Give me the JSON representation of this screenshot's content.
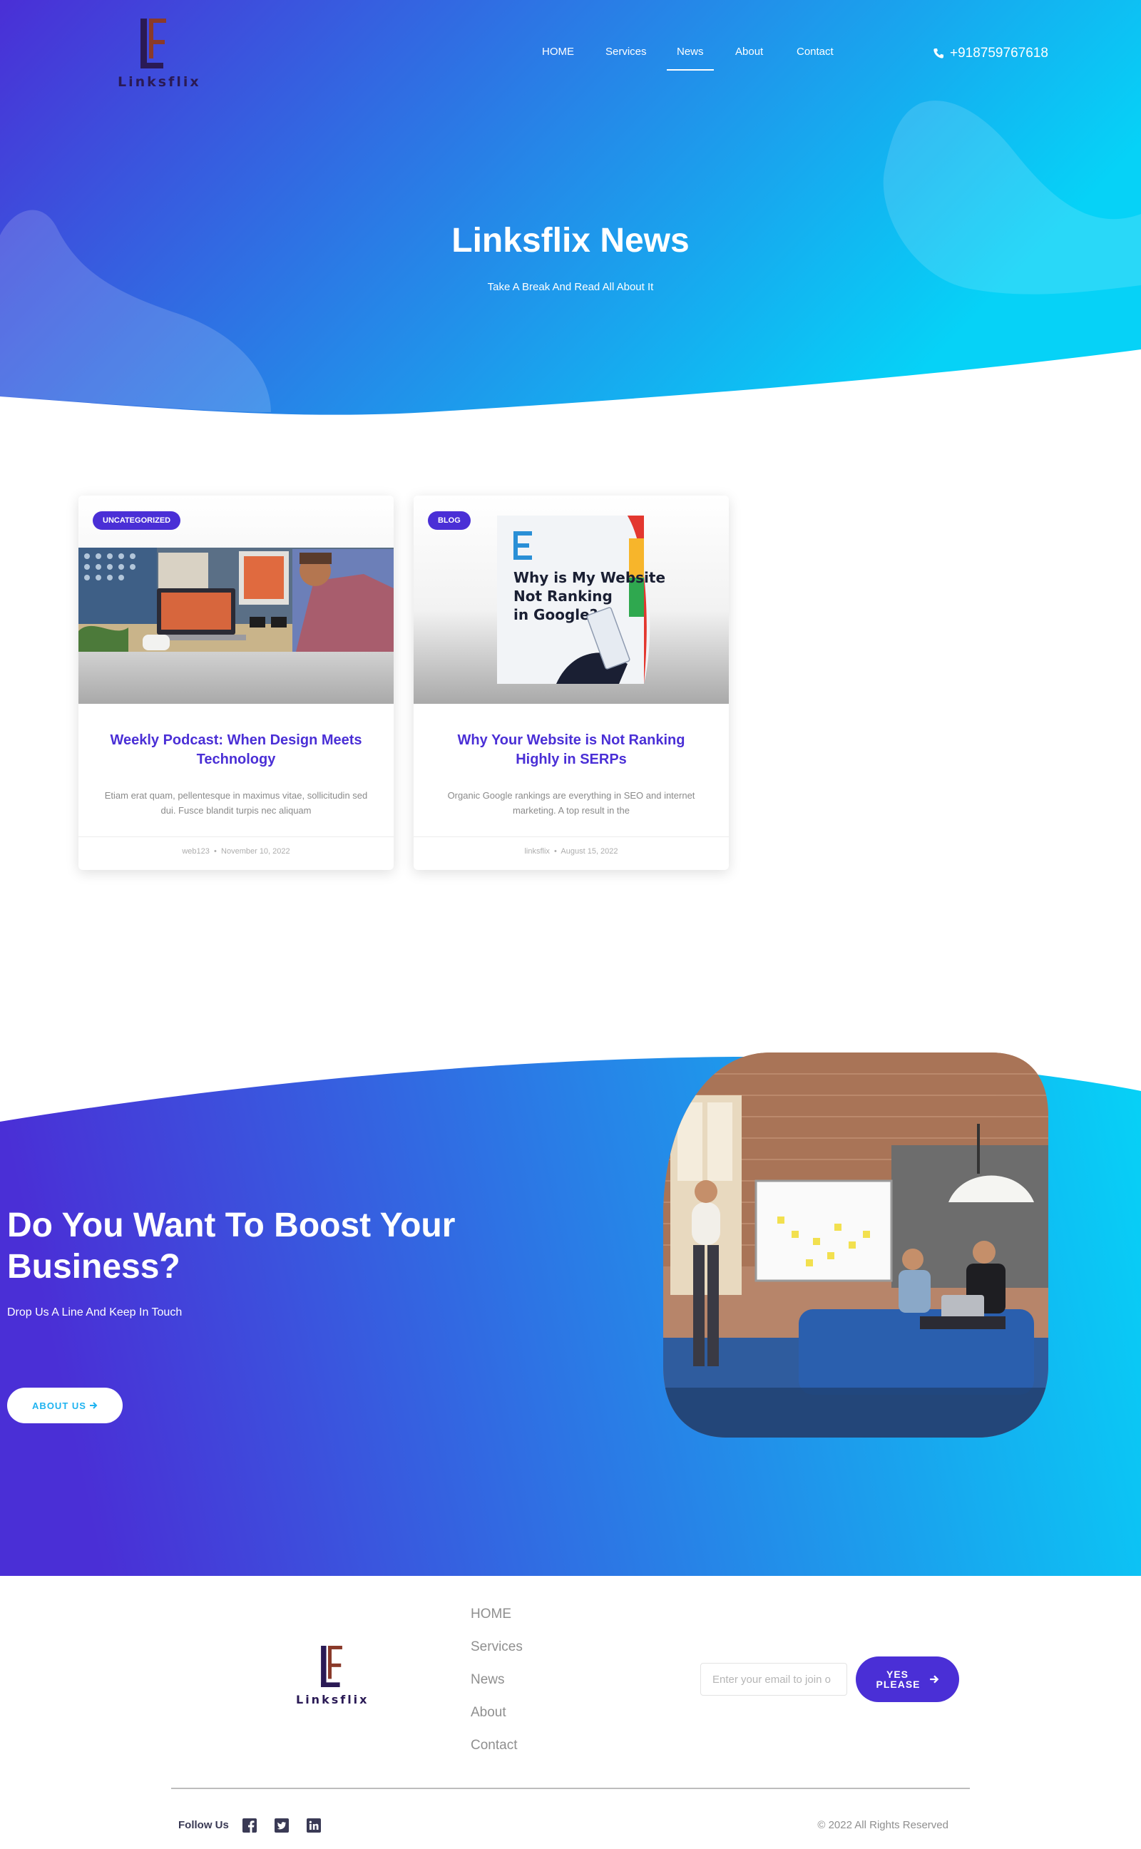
{
  "brand": {
    "name": "Linksflix",
    "logo_icon": "linksflix-e-logo-icon"
  },
  "nav": {
    "items": [
      {
        "label": "HOME"
      },
      {
        "label": "Services"
      },
      {
        "label": "News"
      },
      {
        "label": "About"
      },
      {
        "label": "Contact"
      }
    ],
    "active": "News"
  },
  "phone": {
    "icon": "phone-icon",
    "number": "+918759767618"
  },
  "hero": {
    "title": "Linksflix News",
    "subtitle": "Take A Break And Read All About It"
  },
  "posts": [
    {
      "category": "UNCATEGORIZED",
      "image": "person-working-at-laptop-desk-photo",
      "title": "Weekly Podcast: When Design Meets Technology",
      "excerpt": "Etiam erat quam, pellentesque in maximus vitae, sollicitudin sed dui. Fusce blandit turpis nec aliquam",
      "author": "web123",
      "separator": "•",
      "date": "November 10, 2022"
    },
    {
      "category": "BLOG",
      "image": "why-is-my-website-not-ranking-graphic",
      "image_text": [
        "Why is My Website",
        "Not Ranking",
        "in Google?"
      ],
      "title": "Why Your Website is Not Ranking Highly in SERPs",
      "excerpt": "Organic Google rankings are everything in SEO and internet marketing. A top result in the",
      "author": "linksflix",
      "separator": "•",
      "date": "August 15, 2022"
    }
  ],
  "cta": {
    "title": "Do You Want To Boost Your Business?",
    "subtitle": "Drop Us A Line And Keep In Touch",
    "button": "ABOUT US",
    "button_icon": "arrow-right-icon",
    "image": "team-meeting-office-photo"
  },
  "footer": {
    "nav": [
      "HOME",
      "Services",
      "News",
      "About",
      "Contact"
    ],
    "email_placeholder": "Enter your email to join o",
    "subscribe_label": "YES PLEASE",
    "subscribe_icon": "arrow-right-icon",
    "follow_label": "Follow Us",
    "social_icons": [
      "facebook-icon",
      "twitter-icon",
      "linkedin-icon"
    ],
    "copyright": "© 2022 All Rights Reserved"
  },
  "colors": {
    "gradient_start": "#4a2fd6",
    "gradient_end": "#06d2f7",
    "accent": "#4a2fd6",
    "cta_button_text": "#1fb3f0",
    "logo_dark": "#2a1a55",
    "logo_accent": "#8a3a2a"
  }
}
